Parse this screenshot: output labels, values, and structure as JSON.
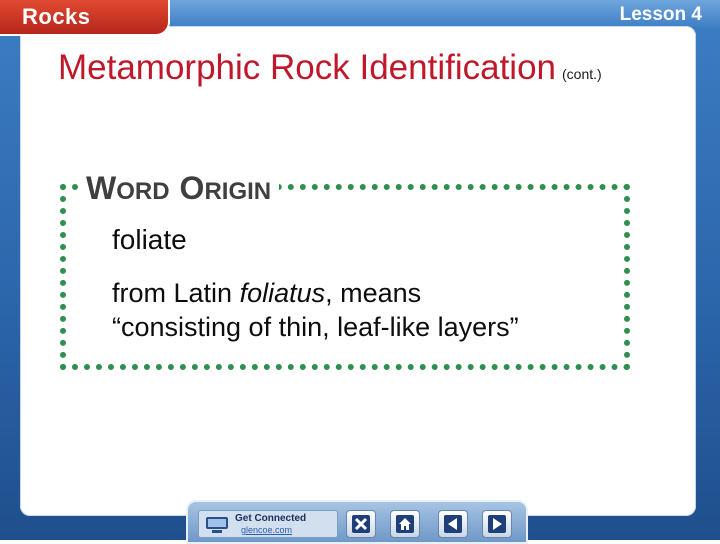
{
  "header": {
    "chapter_tab": "Rocks",
    "lesson": "Lesson 4"
  },
  "slide": {
    "title": "Metamorphic Rock Identification",
    "title_suffix": "(cont.)",
    "word_origin": {
      "heading": {
        "w_cap": "W",
        "w_rest": "ORD",
        "o_cap": "O",
        "o_rest": "RIGIN"
      },
      "term": "foliate",
      "definition_pre": "from Latin ",
      "definition_italic": "foliatus",
      "definition_post": ", means",
      "definition_line2": "“consisting of thin, leaf-like layers”"
    }
  },
  "toolbar": {
    "connect_title": "Get Connected",
    "connect_url": "glencoe.com",
    "buttons": [
      {
        "icon": "close-icon"
      },
      {
        "icon": "home-icon"
      },
      {
        "icon": "previous-arrow-icon"
      },
      {
        "icon": "next-arrow-icon"
      }
    ]
  },
  "colors": {
    "frame_blue": "#2a63a8",
    "title_red": "#c0182b",
    "tab_red": "#b7261b",
    "origin_green": "#2f8f4e"
  }
}
